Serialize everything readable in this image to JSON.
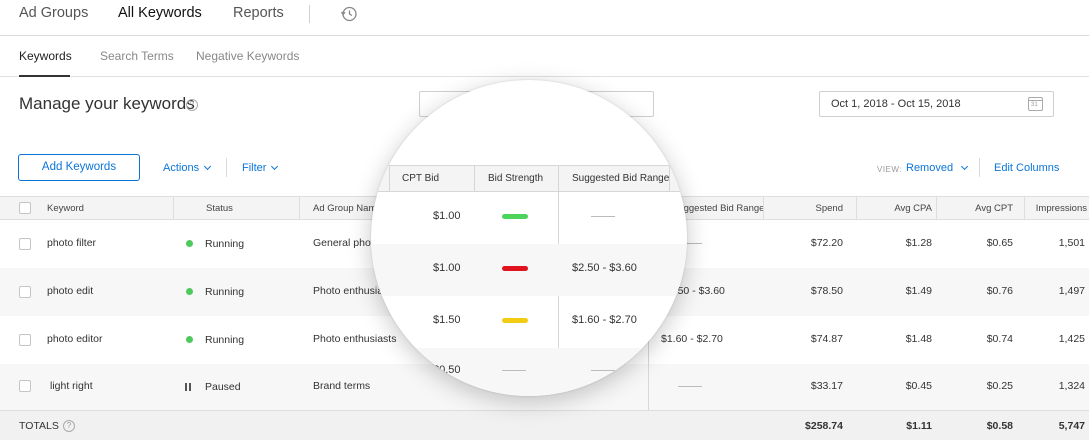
{
  "topnav": {
    "tabs": [
      {
        "label": "Ad Groups",
        "active": false
      },
      {
        "label": "All Keywords",
        "active": true
      },
      {
        "label": "Reports",
        "active": false
      }
    ],
    "history_icon": "history-icon"
  },
  "subnav": {
    "tabs": [
      {
        "label": "Keywords",
        "active": true
      },
      {
        "label": "Search Terms",
        "active": false
      },
      {
        "label": "Negative Keywords",
        "active": false
      }
    ]
  },
  "page": {
    "title": "Manage your keywords",
    "help": "?",
    "search_value": "",
    "date_range": "Oct 1, 2018 - Oct 15, 2018",
    "calendar_day": "31"
  },
  "toolbar": {
    "add_label": "Add Keywords",
    "actions_label": "Actions",
    "filter_label": "Filter",
    "view_label": "VIEW:",
    "view_value": "Removed",
    "edit_columns_label": "Edit Columns"
  },
  "table": {
    "columns": {
      "keyword": "Keyword",
      "status": "Status",
      "ad_group": "Ad Group Name",
      "suggested": "Suggested Bid Range",
      "spend": "Spend",
      "avg_cpa": "Avg CPA",
      "avg_cpt": "Avg CPT",
      "impressions": "Impressions"
    },
    "rows": [
      {
        "keyword": "photo filter",
        "status": "Running",
        "ad_group": "General photo",
        "suggested": "",
        "spend": "$72.20",
        "avg_cpa": "$1.28",
        "avg_cpt": "$0.65",
        "impressions": "1,501"
      },
      {
        "keyword": "photo edit",
        "status": "Running",
        "ad_group": "Photo enthusiasts",
        "suggested": "$2.50 - $3.60",
        "spend": "$78.50",
        "avg_cpa": "$1.49",
        "avg_cpt": "$0.76",
        "impressions": "1,497"
      },
      {
        "keyword": "photo editor",
        "status": "Running",
        "ad_group": "Photo enthusiasts",
        "suggested": "$1.60 - $2.70",
        "spend": "$74.87",
        "avg_cpa": "$1.48",
        "avg_cpt": "$0.74",
        "impressions": "1,425"
      },
      {
        "keyword": "light right",
        "status": "Paused",
        "ad_group": "Brand terms",
        "suggested": "",
        "spend": "$33.17",
        "avg_cpa": "$0.45",
        "avg_cpt": "$0.25",
        "impressions": "1,324"
      }
    ],
    "totals": {
      "label": "TOTALS",
      "spend": "$258.74",
      "avg_cpa": "$1.11",
      "avg_cpt": "$0.58",
      "impressions": "5,747"
    }
  },
  "magnifier": {
    "columns": {
      "cpt_bid": "CPT Bid",
      "bid_strength": "Bid Strength",
      "suggested": "Suggested Bid Range"
    },
    "rows": [
      {
        "cpt_bid": "$1.00",
        "strength_color": "#4cd45c",
        "suggested": ""
      },
      {
        "cpt_bid": "$1.00",
        "strength_color": "#e0141e",
        "suggested": "$2.50 - $3.60"
      },
      {
        "cpt_bid": "$1.50",
        "strength_color": "#f2cc12",
        "suggested": "$1.60 - $2.70"
      },
      {
        "cpt_bid": "$0.50",
        "strength_color": "",
        "suggested": ""
      }
    ]
  },
  "colors": {
    "accent": "#0b74d9",
    "running": "#4ec95c"
  }
}
